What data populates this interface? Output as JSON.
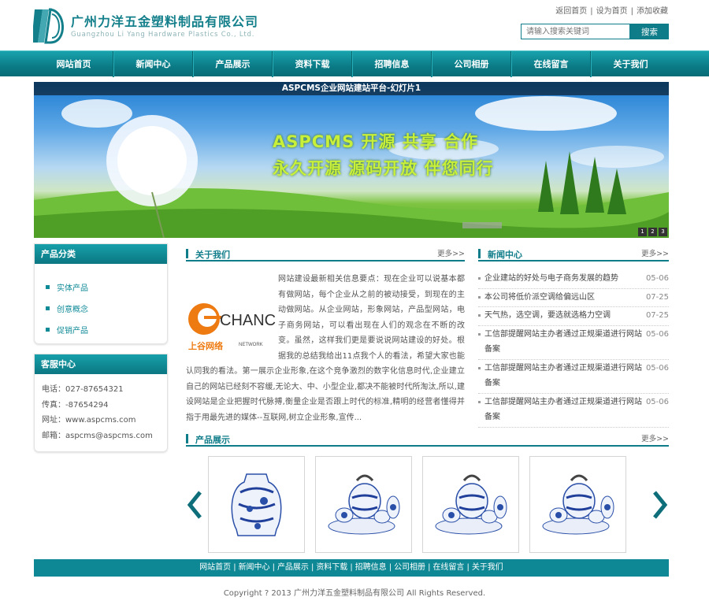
{
  "header": {
    "company_name": "广州力洋五金塑料制品有限公司",
    "company_en": "Guangzhou Li Yang Hardware Plastics Co., Ltd.",
    "top_links": [
      "返回首页",
      "设为首页",
      "添加收藏"
    ],
    "search_placeholder": "请输入搜索关键词",
    "search_button": "搜索"
  },
  "nav": {
    "items": [
      "网站首页",
      "新闻中心",
      "产品展示",
      "资料下载",
      "招聘信息",
      "公司相册",
      "在线留言",
      "关于我们"
    ]
  },
  "banner": {
    "title": "ASPCMS企业网站建站平台-幻灯片1",
    "line1": "ASPCMS 开源  共享  合作",
    "line2": "永久开源 源码开放  伴您同行",
    "dots": [
      "1",
      "2",
      "3"
    ]
  },
  "sidebar": {
    "category_title": "产品分类",
    "categories": [
      "实体产品",
      "创意概念",
      "促销产品"
    ],
    "service_title": "客服中心",
    "service_lines": [
      "电话：027-87654321",
      "传真：-87654294",
      "网址：www.aspcms.com",
      "邮箱：aspcms@aspcms.com"
    ]
  },
  "about": {
    "title": "关于我们",
    "more": "更多>>",
    "logo_text": "CHANCOO",
    "logo_sub": "上谷网络",
    "logo_network": "NETWORK",
    "text": "网站建设最新相关信息要点：现在企业可以说基本都有做网站，每个企业从之前的被动接受，到现在的主动做网站。从企业网站，形象网站，产品型网站，电子商务网站，可以看出现在人们的观念在不断的改变。虽然，这样我们更是要说说网站建设的好处。根据我的总结我给出11点我个人的看法，希望大家也能认同我的看法。第一展示企业形象,在这个竞争激烈的数字化信息时代,企业建立自己的网站已经刻不容缓,无论大、中、小型企业,都决不能被时代所淘汰,所以,建设网站是企业把握时代脉搏,衡量企业是否跟上时代的标准,精明的经营者懂得并指于用最先进的媒体--互联网,树立企业形象,宣传..."
  },
  "news": {
    "title": "新闻中心",
    "more": "更多>>",
    "items": [
      {
        "title": "企业建站的好处与电子商务发展的趋势",
        "date": "05-06"
      },
      {
        "title": "本公司将低价派空调给偏远山区",
        "date": "07-25"
      },
      {
        "title": "天气热，选空调，要选就选格力空调",
        "date": "07-25"
      },
      {
        "title": "工信部提醒网站主办者通过正规渠道进行网站备案",
        "date": "05-06"
      },
      {
        "title": "工信部提醒网站主办者通过正规渠道进行网站备案",
        "date": "05-06"
      },
      {
        "title": "工信部提醒网站主办者通过正规渠道进行网站备案",
        "date": "05-06"
      }
    ]
  },
  "products": {
    "title": "产品展示",
    "more": "更多>>"
  },
  "footer": {
    "links": [
      "网站首页",
      "新闻中心",
      "产品展示",
      "资料下载",
      "招聘信息",
      "公司相册",
      "在线留言",
      "关于我们"
    ],
    "copyright": "Copyright ? 2013 广州力洋五金塑料制品有限公司 All Rights Reserved."
  },
  "colors": {
    "brand": "#0e7c89",
    "slogan": "#c8ef3a"
  }
}
